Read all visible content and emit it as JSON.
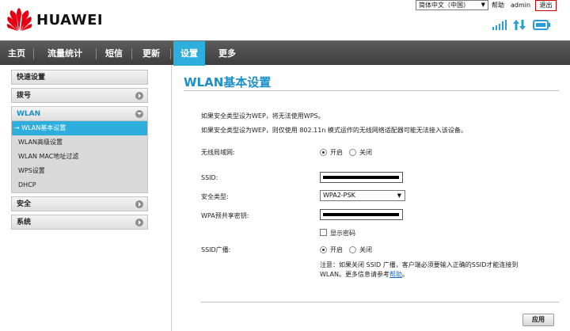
{
  "header": {
    "brand": "HUAWEI",
    "language": "简体中文（中国）",
    "help": "帮助",
    "user": "admin",
    "logout": "退出"
  },
  "nav": {
    "items": [
      "主页",
      "流量统计",
      "短信",
      "更新",
      "设置",
      "更多"
    ],
    "active": "设置"
  },
  "sidebar": {
    "quick_setup": "快速设置",
    "dialup": "拨号",
    "wlan": "WLAN",
    "wlan_items": [
      "→ WLAN基本设置",
      "WLAN高级设置",
      "WLAN MAC地址过滤",
      "WPS设置",
      "DHCP"
    ],
    "security": "安全",
    "system": "系统"
  },
  "main": {
    "title": "WLAN基本设置",
    "note1": "如果安全类型设为WEP，将无法使用WPS。",
    "note2": "如果安全类型设为WEP，则仅使用 802.11n 模式运作的无线网络适配器可能无法接入该设备。",
    "wireless_label": "无线局域网:",
    "wireless_on": "开启",
    "wireless_off": "关闭",
    "wireless_value": "on",
    "ssid_label": "SSID:",
    "security_label": "安全类型:",
    "security_value": "WPA2-PSK",
    "wpa_key_label": "WPA预共享密钥:",
    "show_password": "显示密码",
    "broadcast_label": "SSID广播:",
    "broadcast_on": "开启",
    "broadcast_off": "关闭",
    "broadcast_value": "on",
    "broadcast_note": "注意：如果关闭 SSID 广播，客户端必须要输入正确的SSID才能连接到",
    "broadcast_note2_prefix": "WLAN。更多信息请参考",
    "broadcast_note2_link": "帮助",
    "broadcast_note2_suffix": "。",
    "apply": "应用"
  },
  "colors": {
    "accent": "#2eaedc",
    "title": "#1a8fc8",
    "navbar": "#4a4a4a",
    "logo_red": "#e60012"
  },
  "icons": [
    "huawei-logo",
    "signal-icon",
    "data-transfer-icon",
    "battery-icon"
  ]
}
